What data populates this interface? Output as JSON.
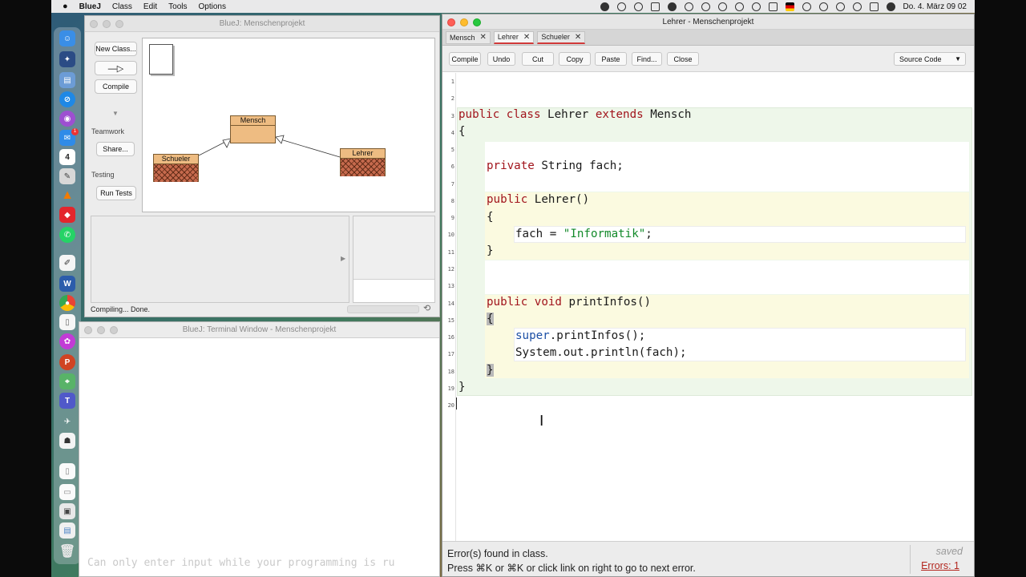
{
  "menubar": {
    "apple": "",
    "app": "BlueJ",
    "menus": [
      "Class",
      "Edit",
      "Tools",
      "Options"
    ],
    "clock": "Do. 4. März  09 02"
  },
  "dock": {
    "items": [
      "finder-icon",
      "launchpad-icon",
      "preview-icon",
      "safari-icon",
      "podcasts-icon",
      "mail-icon",
      "calendar-icon",
      "script-editor-icon",
      "vlc-icon",
      "anydesk-icon",
      "whatsapp-icon",
      "pages-icon",
      "word-icon",
      "chrome-icon",
      "textedit-icon",
      "flower-icon",
      "powerpoint-icon",
      "maps-icon",
      "teams-icon",
      "bluej-icon",
      "bluej-projects-icon",
      "document-icon",
      "document-icon",
      "image-icon",
      "folder-icon",
      "trash-icon"
    ],
    "calendar_day": "4",
    "mail_badge": "1"
  },
  "main_window": {
    "title": "BlueJ:  Menschenprojekt",
    "buttons": {
      "new_class": "New Class...",
      "compile": "Compile",
      "share": "Share...",
      "run_tests": "Run Tests"
    },
    "sections": {
      "teamwork": "Teamwork",
      "testing": "Testing"
    },
    "classes": {
      "mensch": "Mensch",
      "schueler": "Schueler",
      "lehrer": "Lehrer"
    },
    "status": "Compiling... Done."
  },
  "terminal": {
    "title": "BlueJ: Terminal Window - Menschenprojekt",
    "input_placeholder": "Can only enter input while your programming is ru"
  },
  "editor": {
    "title": "Lehrer - Menschenprojekt",
    "tabs": [
      {
        "label": "Mensch",
        "active": false
      },
      {
        "label": "Lehrer",
        "active": true
      },
      {
        "label": "Schueler",
        "active": false
      }
    ],
    "toolbar": {
      "compile": "Compile",
      "undo": "Undo",
      "cut": "Cut",
      "copy": "Copy",
      "paste": "Paste",
      "find": "Find...",
      "close": "Close"
    },
    "view": "Source Code",
    "line_numbers": [
      "1",
      "2",
      "3",
      "4",
      "5",
      "6",
      "7",
      "8",
      "9",
      "10",
      "11",
      "12",
      "13",
      "14",
      "15",
      "16",
      "17",
      "18",
      "19",
      "20"
    ],
    "code": {
      "l3_a": "public",
      "l3_b": " ",
      "l3_c": "class",
      "l3_d": " Lehrer ",
      "l3_e": "extends",
      "l3_f": " Mensch",
      "l4": "{",
      "l6_a": "private",
      "l6_b": " String fach;",
      "l8_a": "public",
      "l8_b": " Lehrer()",
      "l9": "{",
      "l10_a": "fach = ",
      "l10_b": "\"Informatik\"",
      "l10_c": ";",
      "l11": "}",
      "l14_a": "public",
      "l14_b": " ",
      "l14_c": "void",
      "l14_d": " printInfos()",
      "l15": "{",
      "l16_a": "super",
      "l16_b": ".printInfos();",
      "l17": "System.out.println(fach);",
      "l18": "}",
      "l19": "}"
    },
    "error_line1": "Error(s) found in class.",
    "error_line2": "Press ⌘K or ⌘K or click link on right to go to next error.",
    "saved": "saved",
    "errors": "Errors: 1"
  }
}
